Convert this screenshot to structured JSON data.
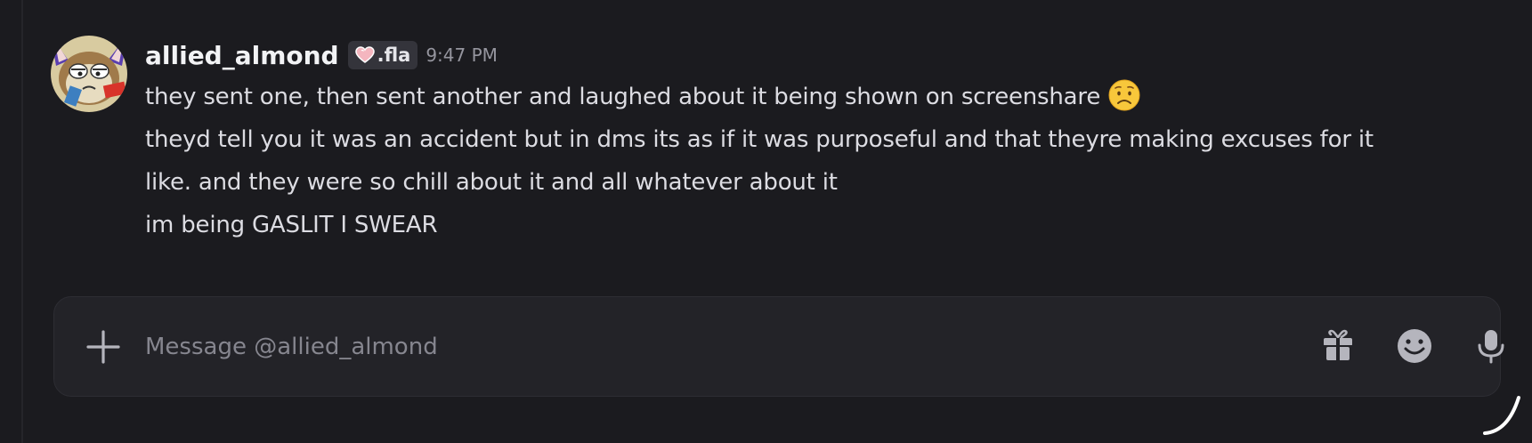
{
  "message": {
    "username": "allied_almond",
    "tag": ".fla",
    "timestamp": "9:47 PM",
    "lines": [
      "they sent one, then sent another and laughed about it being shown on screenshare",
      "theyd tell you it was an accident but in dms its as if it was purposeful and that theyre making excuses for it",
      "like. and they were so chill about it and all whatever about it",
      "im being GASLIT I SWEAR"
    ],
    "emoji": "worried-face"
  },
  "composer": {
    "placeholder": "Message @allied_almond",
    "value": "",
    "icons": [
      "plus-icon",
      "gift-icon",
      "emoji-icon",
      "microphone-icon"
    ]
  },
  "colors": {
    "background": "#1b1b1f",
    "composer": "#232328",
    "username": "#f2f3f5",
    "text": "#dcdce2",
    "muted": "#95959e",
    "icon": "#b5b5bd"
  }
}
